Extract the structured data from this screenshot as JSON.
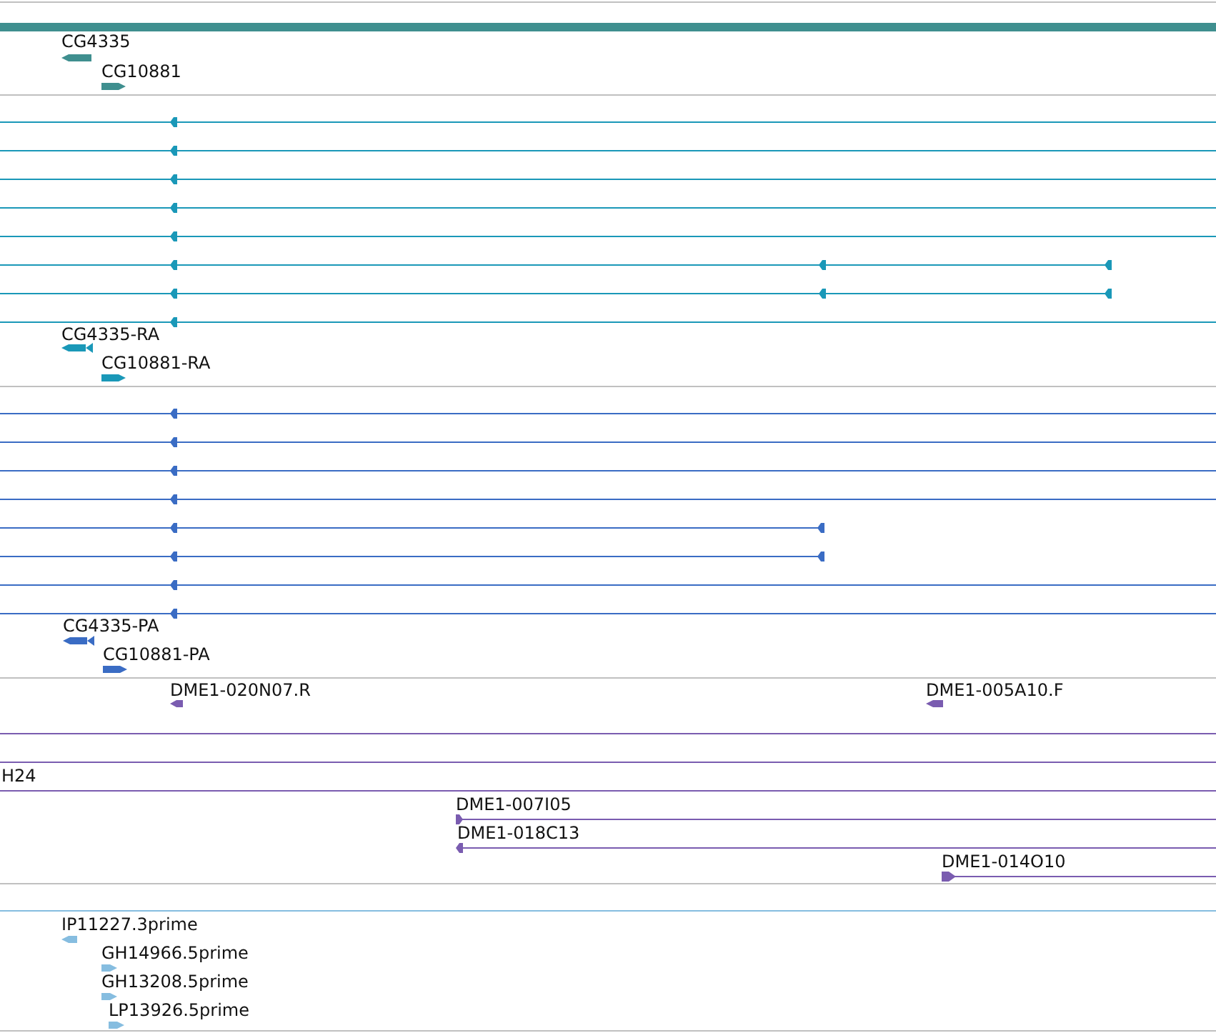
{
  "tracks": [
    {
      "color": "#3f8f8f",
      "features": [
        {
          "kind": "bar"
        },
        {
          "kind": "gene",
          "label": "CG4335",
          "reverse": true
        },
        {
          "kind": "gene",
          "label": "CG10881",
          "reverse": false
        }
      ]
    },
    {
      "color": "#1a98b8",
      "features": [
        {
          "kind": "line",
          "reverse": true
        },
        {
          "kind": "line",
          "reverse": true
        },
        {
          "kind": "line",
          "reverse": true
        },
        {
          "kind": "line",
          "reverse": true
        },
        {
          "kind": "line",
          "reverse": true
        },
        {
          "kind": "line",
          "reverse": true
        },
        {
          "kind": "line",
          "reverse": true
        },
        {
          "kind": "line",
          "reverse": true
        },
        {
          "kind": "gene",
          "label": "CG4335-RA",
          "reverse": true
        },
        {
          "kind": "gene",
          "label": "CG10881-RA",
          "reverse": false
        }
      ]
    },
    {
      "color": "#3a6cc4",
      "features": [
        {
          "kind": "line",
          "reverse": true
        },
        {
          "kind": "line",
          "reverse": true
        },
        {
          "kind": "line",
          "reverse": true
        },
        {
          "kind": "line",
          "reverse": true
        },
        {
          "kind": "line",
          "reverse": true
        },
        {
          "kind": "line",
          "reverse": true
        },
        {
          "kind": "line",
          "reverse": true
        },
        {
          "kind": "line",
          "reverse": true
        },
        {
          "kind": "gene",
          "label": "CG4335-PA",
          "reverse": true
        },
        {
          "kind": "gene",
          "label": "CG10881-PA",
          "reverse": false
        }
      ]
    },
    {
      "color": "#7a5cb0",
      "features": [
        {
          "kind": "gene",
          "label": "DME1-020N07.R",
          "reverse": true
        },
        {
          "kind": "gene",
          "label": "DME1-005A10.F",
          "reverse": true
        },
        {
          "kind": "plain"
        },
        {
          "kind": "plain"
        },
        {
          "kind": "plain",
          "label": "H24"
        },
        {
          "kind": "line",
          "label": "DME1-007I05",
          "reverse": false
        },
        {
          "kind": "line",
          "label": "DME1-018C13",
          "reverse": true
        },
        {
          "kind": "line",
          "label": "DME1-014O10",
          "reverse": false
        }
      ]
    },
    {
      "color": "#86bde0",
      "features": [
        {
          "kind": "plain"
        },
        {
          "kind": "gene",
          "label": "IP11227.3prime",
          "reverse": true
        },
        {
          "kind": "gene",
          "label": "GH14966.5prime",
          "reverse": false
        },
        {
          "kind": "gene",
          "label": "GH13208.5prime",
          "reverse": false
        },
        {
          "kind": "gene",
          "label": "LP13926.5prime",
          "reverse": false
        }
      ]
    }
  ]
}
